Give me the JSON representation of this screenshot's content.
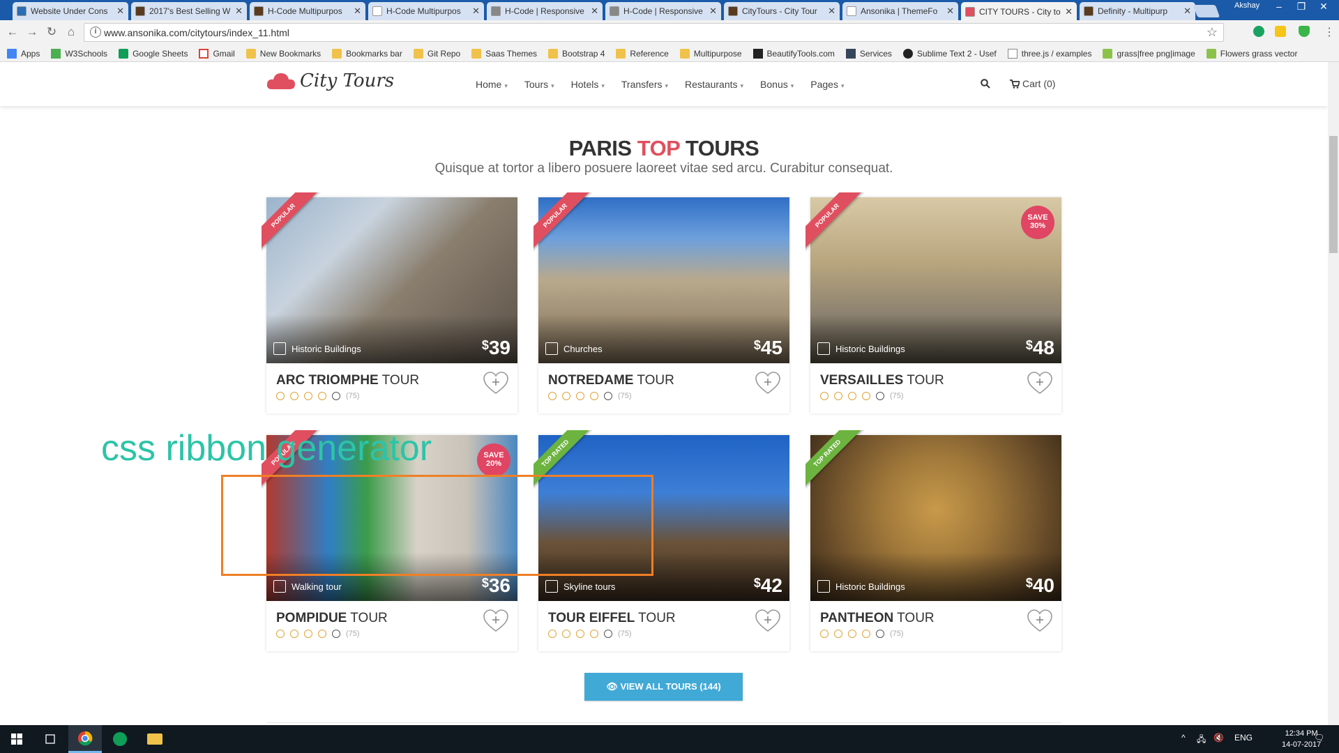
{
  "browser": {
    "tabs": [
      {
        "label": "Website Under Cons",
        "favicon_color": "#2a6db5"
      },
      {
        "label": "2017's Best Selling W",
        "favicon_color": "#5a3b1f"
      },
      {
        "label": "H-Code Multipurpos",
        "favicon_color": "#5a3b1f"
      },
      {
        "label": "H-Code Multipurpos",
        "favicon_color": "#ffffff"
      },
      {
        "label": "H-Code | Responsive",
        "favicon_color": "#888888"
      },
      {
        "label": "H-Code | Responsive",
        "favicon_color": "#888888"
      },
      {
        "label": "CityTours - City Tour",
        "favicon_color": "#5a3b1f"
      },
      {
        "label": "Ansonika | ThemeFo",
        "favicon_color": "#ffffff"
      },
      {
        "label": "CITY TOURS - City to",
        "favicon_color": "#e04f5f",
        "active": true
      },
      {
        "label": "Definity - Multipurp",
        "favicon_color": "#5a3b1f"
      }
    ],
    "profile_name": "Akshay",
    "url": "www.ansonika.com/citytours/index_11.html",
    "bookmarks": [
      {
        "label": "Apps",
        "icon": "apps-icon"
      },
      {
        "label": "W3Schools",
        "icon": "w3schools-icon"
      },
      {
        "label": "Google Sheets",
        "icon": "sheets-icon"
      },
      {
        "label": "Gmail",
        "icon": "gmail-icon"
      },
      {
        "label": "New Bookmarks",
        "icon": "folder-icon"
      },
      {
        "label": "Bookmarks bar",
        "icon": "folder-icon"
      },
      {
        "label": "Git Repo",
        "icon": "folder-icon"
      },
      {
        "label": "Saas Themes",
        "icon": "folder-icon"
      },
      {
        "label": "Bootstrap 4",
        "icon": "folder-icon"
      },
      {
        "label": "Reference",
        "icon": "folder-icon"
      },
      {
        "label": "Multipurpose",
        "icon": "folder-icon"
      },
      {
        "label": "BeautifyTools.com",
        "icon": "bt-icon"
      },
      {
        "label": "Services",
        "icon": "tumblr-icon"
      },
      {
        "label": "Sublime Text 2 - Usef",
        "icon": "github-icon"
      },
      {
        "label": "three.js / examples",
        "icon": "page-icon"
      },
      {
        "label": "grass|free png|image",
        "icon": "green-icon"
      },
      {
        "label": "Flowers grass vector",
        "icon": "green-icon"
      }
    ]
  },
  "site": {
    "logo_text": "City Tours",
    "nav": [
      "Home",
      "Tours",
      "Hotels",
      "Transfers",
      "Restaurants",
      "Bonus",
      "Pages"
    ],
    "cart_label": "Cart (0)",
    "title_part1": "PARIS",
    "title_accent": "TOP",
    "title_part2": "TOURS",
    "subtitle": "Quisque at tortor a libero posuere laoreet vitae sed arcu. Curabitur consequat.",
    "accent_color": "#e04f5f",
    "tours": [
      {
        "name_bold": "ARC TRIOMPHE",
        "name_rest": "TOUR",
        "category": "Historic Buildings",
        "price": "39",
        "ribbon": "POPULAR",
        "ribbon_color": "#e04f5f",
        "save": "",
        "rating_count": "(75)",
        "smiles_on": 4,
        "category_icon": "historic-building-icon"
      },
      {
        "name_bold": "NOTREDAME",
        "name_rest": "TOUR",
        "category": "Churches",
        "price": "45",
        "ribbon": "POPULAR",
        "ribbon_color": "#e04f5f",
        "save": "",
        "rating_count": "(75)",
        "smiles_on": 4,
        "category_icon": "church-icon"
      },
      {
        "name_bold": "VERSAILLES",
        "name_rest": "TOUR",
        "category": "Historic Buildings",
        "price": "48",
        "ribbon": "POPULAR",
        "ribbon_color": "#e04f5f",
        "save": "SAVE 30%",
        "rating_count": "(75)",
        "smiles_on": 4,
        "category_icon": "historic-building-icon"
      },
      {
        "name_bold": "POMPIDUE",
        "name_rest": "TOUR",
        "category": "Walking tour",
        "price": "36",
        "ribbon": "POPULAR",
        "ribbon_color": "#e04f5f",
        "save": "SAVE 20%",
        "rating_count": "(75)",
        "smiles_on": 4,
        "category_icon": "walking-icon"
      },
      {
        "name_bold": "TOUR EIFFEL",
        "name_rest": "TOUR",
        "category": "Skyline tours",
        "price": "42",
        "ribbon": "TOP RATED",
        "ribbon_color": "#6cb33f",
        "save": "",
        "rating_count": "(75)",
        "smiles_on": 4,
        "category_icon": "skyline-icon"
      },
      {
        "name_bold": "PANTHEON",
        "name_rest": "TOUR",
        "category": "Historic Buildings",
        "price": "40",
        "ribbon": "TOP RATED",
        "ribbon_color": "#6cb33f",
        "save": "",
        "rating_count": "(75)",
        "smiles_on": 4,
        "category_icon": "historic-building-icon"
      }
    ],
    "currency": "$",
    "view_all_label": "VIEW ALL TOURS (144)",
    "view_all_color": "#41a9d6"
  },
  "annotation": {
    "overlay_text": "css ribbon generator",
    "overlay_color": "#2cc4a8",
    "box_color": "#ef7f27"
  },
  "taskbar": {
    "language": "ENG",
    "time": "12:34 PM",
    "date": "14-07-2017"
  }
}
